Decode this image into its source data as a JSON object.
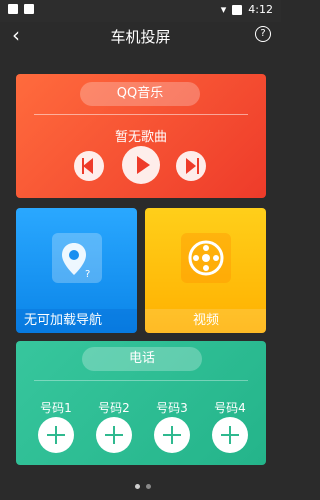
{
  "status": {
    "time": "4:12"
  },
  "appbar": {
    "title": "车机投屏",
    "back_icon": "back-arrow-icon",
    "help_icon": "help-icon"
  },
  "qq_music": {
    "title": "QQ音乐",
    "song": "暂无歌曲"
  },
  "tiles": {
    "navigation": "无可加载导航",
    "video": "视频"
  },
  "phone": {
    "title": "电话",
    "slots": [
      "号码1",
      "号码2",
      "号码3",
      "号码4"
    ]
  },
  "colors": {
    "qq": "#ee3b2a",
    "nav": "#0a84e8",
    "video": "#ffb000",
    "phone": "#24b48a"
  }
}
